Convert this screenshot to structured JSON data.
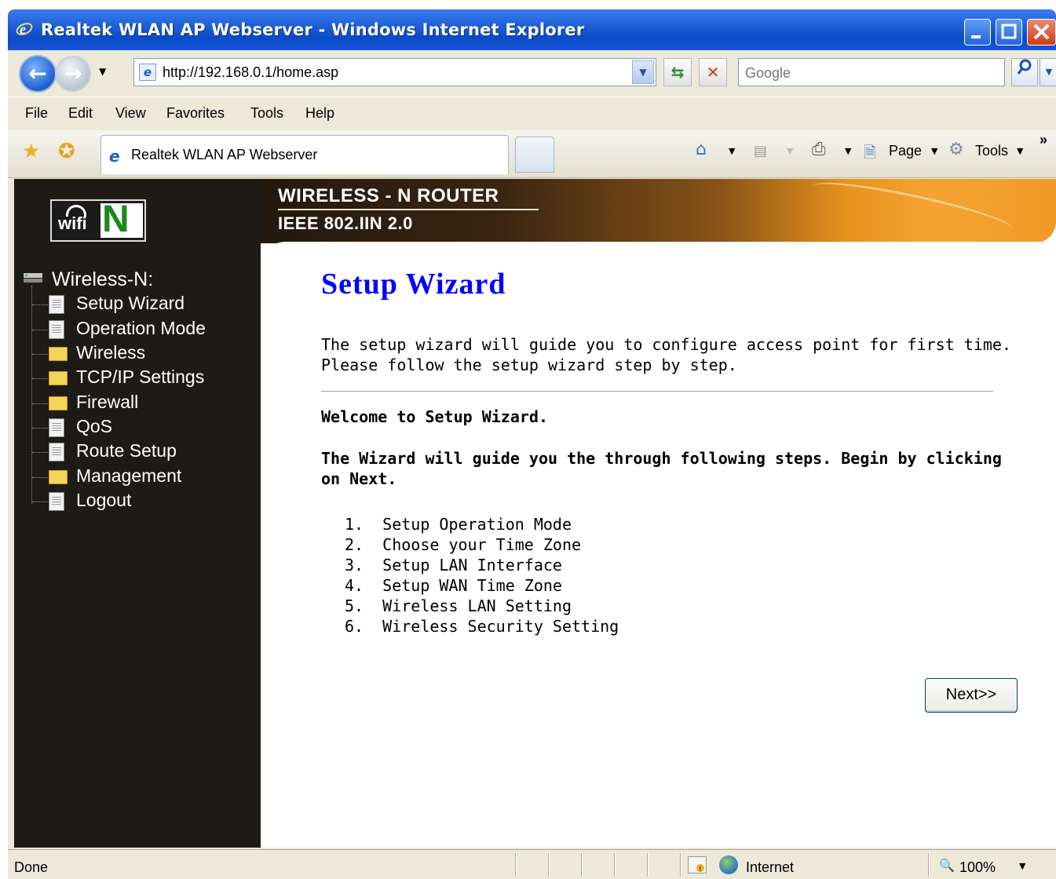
{
  "window": {
    "title": "Realtek WLAN AP Webserver - Windows Internet Explorer"
  },
  "address_bar": {
    "url": "http://192.168.0.1/home.asp",
    "search_placeholder": "Google"
  },
  "menu": [
    "File",
    "Edit",
    "View",
    "Favorites",
    "Tools",
    "Help"
  ],
  "tab": {
    "label": "Realtek WLAN AP Webserver"
  },
  "command_bar": {
    "page_label": "Page",
    "tools_label": "Tools",
    "chevron": "»"
  },
  "banner": {
    "title": "WIRELESS - N ROUTER",
    "subtitle": "IEEE 802.IIN 2.0"
  },
  "logo": {
    "wifi_text": "wifi",
    "n_text": "N"
  },
  "sidebar": {
    "root_label": "Wireless-N:",
    "items": [
      {
        "label": "Setup Wizard",
        "icon": "document-icon"
      },
      {
        "label": "Operation Mode",
        "icon": "document-icon"
      },
      {
        "label": "Wireless",
        "icon": "folder-icon"
      },
      {
        "label": "TCP/IP Settings",
        "icon": "folder-icon"
      },
      {
        "label": "Firewall",
        "icon": "folder-icon"
      },
      {
        "label": "QoS",
        "icon": "document-icon"
      },
      {
        "label": "Route Setup",
        "icon": "document-icon"
      },
      {
        "label": "Management",
        "icon": "folder-icon"
      },
      {
        "label": "Logout",
        "icon": "document-icon"
      }
    ]
  },
  "main": {
    "title": "Setup Wizard",
    "intro": "The setup wizard will guide you to configure access point for first time. Please follow the setup wizard step by step.",
    "welcome": "Welcome to Setup Wizard.",
    "guide": "The Wizard will guide you the through following steps. Begin by clicking on Next.",
    "steps": [
      "1.  Setup Operation Mode",
      "2.  Choose your Time Zone",
      "3.  Setup LAN Interface",
      "4.  Setup WAN Time Zone",
      "5.  Wireless LAN Setting",
      "6.  Wireless Security Setting"
    ],
    "next_label": "Next>>"
  },
  "status_bar": {
    "status": "Done",
    "zone": "Internet",
    "zoom": "100%"
  }
}
